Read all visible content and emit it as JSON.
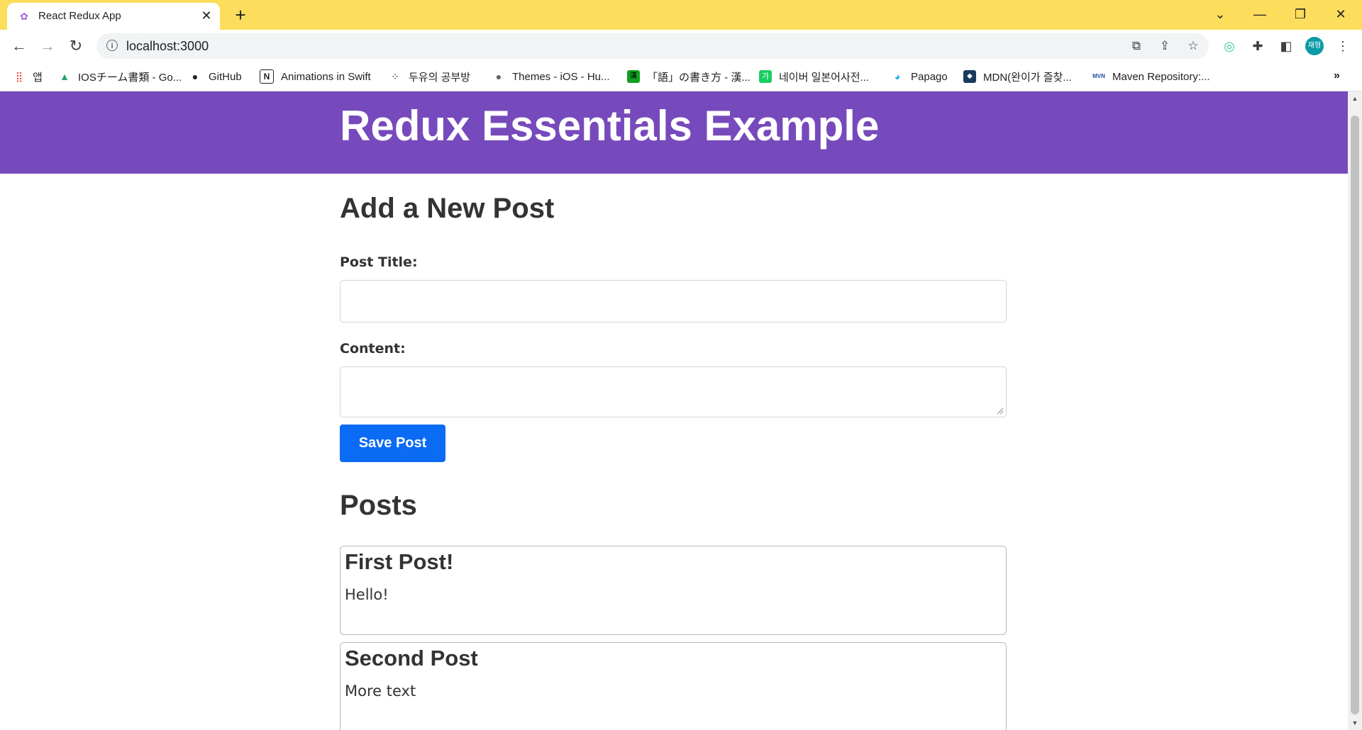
{
  "browser": {
    "tab": {
      "title": "React Redux App",
      "favicon": "redux-favicon",
      "close": "✕"
    },
    "new_tab": "+",
    "window_controls": {
      "tab_search": "⌄",
      "minimize": "—",
      "restore": "❐",
      "close": "✕"
    },
    "url": "localhost:3000",
    "bookmarks": [
      {
        "label": "앱",
        "icon": "apps-grid-icon"
      },
      {
        "label": "IOSチーム書類 - Go...",
        "icon": "google-drive-icon"
      },
      {
        "label": "GitHub",
        "icon": "github-icon"
      },
      {
        "label": "Animations in Swift",
        "icon": "notion-icon"
      },
      {
        "label": "두유의 공부방",
        "icon": "dots-icon"
      },
      {
        "label": "Themes - iOS - Hu...",
        "icon": "apple-icon"
      },
      {
        "label": "「語」の書き方 - 漢...",
        "icon": "kanji-site-icon"
      },
      {
        "label": "네이버 일본어사전...",
        "icon": "naver-dict-icon"
      },
      {
        "label": "Papago",
        "icon": "papago-icon"
      },
      {
        "label": "MDN(완이가 즐찾...",
        "icon": "mdn-icon"
      },
      {
        "label": "Maven Repository:...",
        "icon": "maven-icon"
      }
    ],
    "bookmarks_more": "»",
    "avatar_text": "재형"
  },
  "page": {
    "header_title": "Redux Essentials Example",
    "form": {
      "heading": "Add a New Post",
      "title_label": "Post Title:",
      "title_value": "",
      "content_label": "Content:",
      "content_value": "",
      "save_label": "Save Post"
    },
    "posts_heading": "Posts",
    "posts": [
      {
        "title": "First Post!",
        "content": "Hello!"
      },
      {
        "title": "Second Post",
        "content": "More text"
      }
    ]
  },
  "colors": {
    "tabstrip": "#fddd5c",
    "header": "#764abc",
    "save_button": "#0b6bf5"
  }
}
